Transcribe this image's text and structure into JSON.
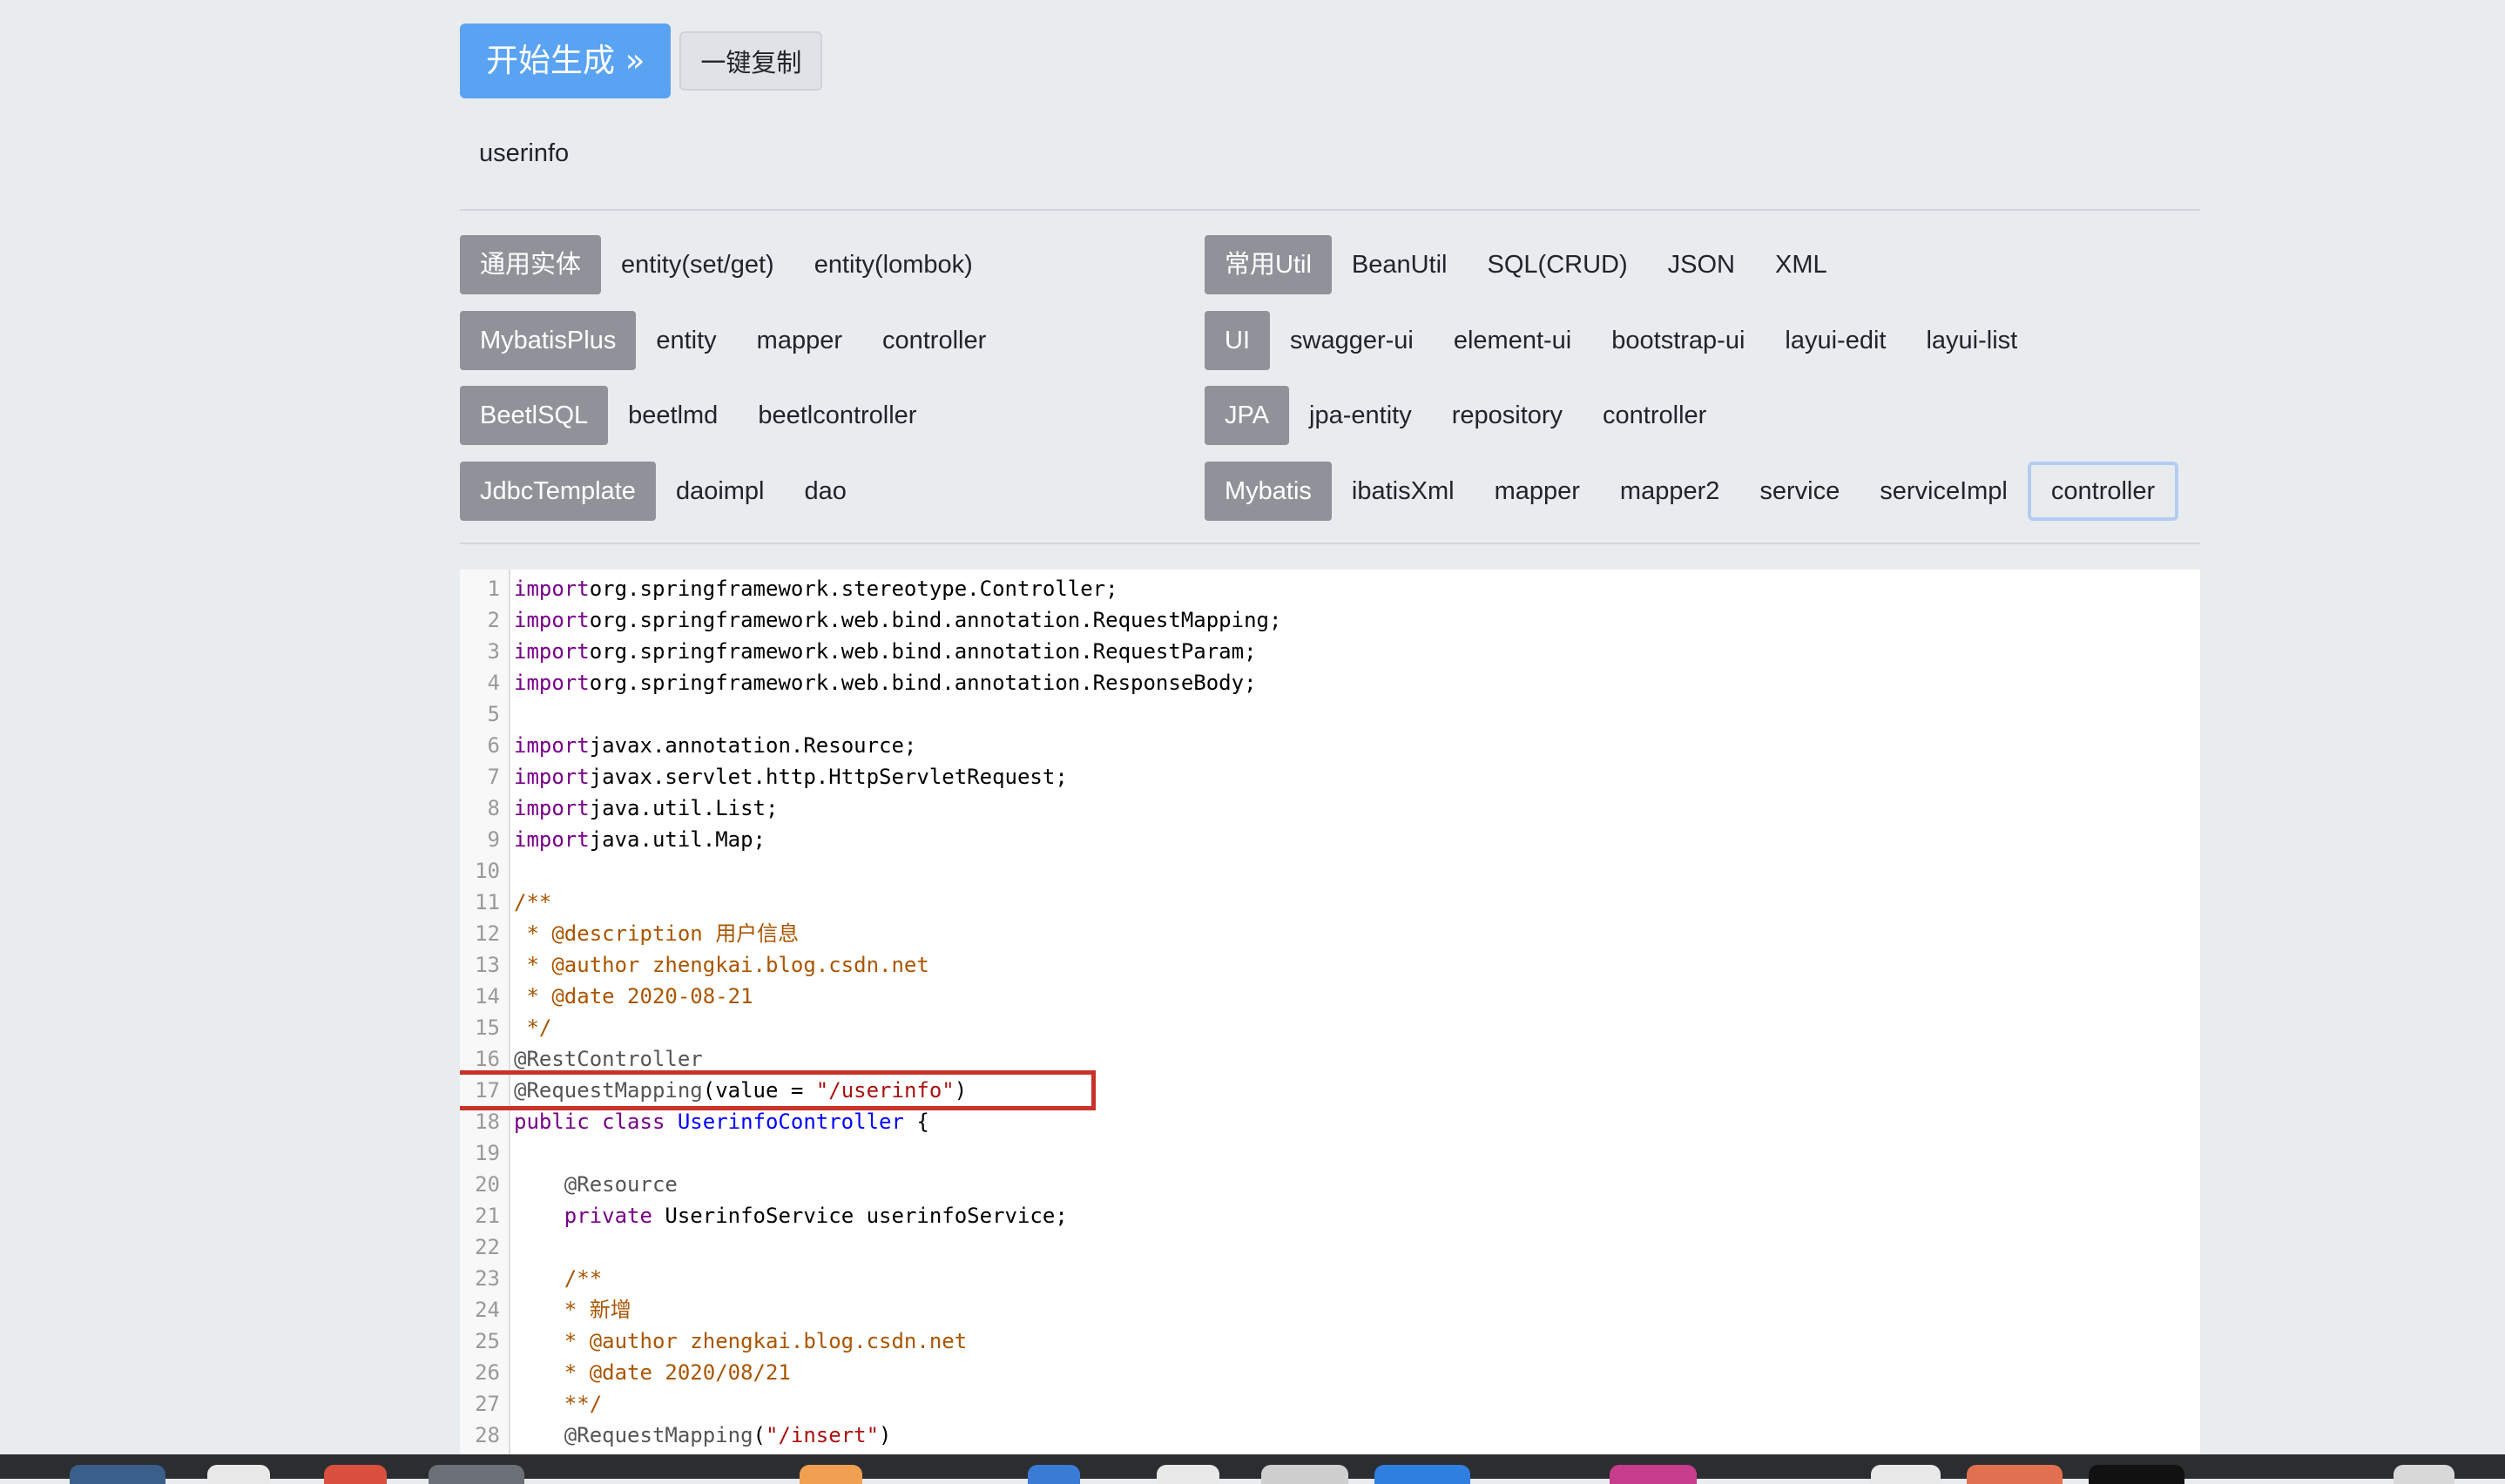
{
  "toolbar": {
    "generate_label": "开始生成 »",
    "copy_label": "一键复制"
  },
  "table_name": "userinfo",
  "templates": {
    "left": [
      {
        "group": "通用实体",
        "items": [
          "entity(set/get)",
          "entity(lombok)"
        ]
      },
      {
        "group": "MybatisPlus",
        "items": [
          "entity",
          "mapper",
          "controller"
        ]
      },
      {
        "group": "BeetlSQL",
        "items": [
          "beetlmd",
          "beetlcontroller"
        ]
      },
      {
        "group": "JdbcTemplate",
        "items": [
          "daoimpl",
          "dao"
        ]
      }
    ],
    "right": [
      {
        "group": "常用Util",
        "items": [
          "BeanUtil",
          "SQL(CRUD)",
          "JSON",
          "XML"
        ]
      },
      {
        "group": "UI",
        "items": [
          "swagger-ui",
          "element-ui",
          "bootstrap-ui",
          "layui-edit",
          "layui-list"
        ]
      },
      {
        "group": "JPA",
        "items": [
          "jpa-entity",
          "repository",
          "controller"
        ]
      },
      {
        "group": "Mybatis",
        "items": [
          "ibatisXml",
          "mapper",
          "mapper2",
          "service",
          "serviceImpl",
          "controller"
        ]
      }
    ],
    "active": "Mybatis/controller"
  },
  "code": {
    "lines": [
      [
        [
          "kw",
          "import"
        ],
        [
          "",
          "org.springframework.stereotype.Controller;"
        ]
      ],
      [
        [
          "kw",
          "import"
        ],
        [
          "",
          "org.springframework.web.bind.annotation.RequestMapping;"
        ]
      ],
      [
        [
          "kw",
          "import"
        ],
        [
          "",
          "org.springframework.web.bind.annotation.RequestParam;"
        ]
      ],
      [
        [
          "kw",
          "import"
        ],
        [
          "",
          "org.springframework.web.bind.annotation.ResponseBody;"
        ]
      ],
      [],
      [
        [
          "kw",
          "import"
        ],
        [
          "",
          "javax.annotation.Resource;"
        ]
      ],
      [
        [
          "kw",
          "import"
        ],
        [
          "",
          "javax.servlet.http.HttpServletRequest;"
        ]
      ],
      [
        [
          "kw",
          "import"
        ],
        [
          "",
          "java.util.List;"
        ]
      ],
      [
        [
          "kw",
          "import"
        ],
        [
          "",
          "java.util.Map;"
        ]
      ],
      [],
      [
        [
          "cmt",
          "/**"
        ]
      ],
      [
        [
          "cmt",
          " * @description 用户信息"
        ]
      ],
      [
        [
          "cmt",
          " * @author zhengkai.blog.csdn.net"
        ]
      ],
      [
        [
          "cmt",
          " * @date 2020-08-21"
        ]
      ],
      [
        [
          "cmt",
          " */"
        ]
      ],
      [
        [
          "meta",
          "@RestController"
        ]
      ],
      [
        [
          "meta",
          "@RequestMapping"
        ],
        [
          "",
          "(value = "
        ],
        [
          "str",
          "\"/userinfo\""
        ],
        [
          "",
          ")"
        ]
      ],
      [
        [
          "kw",
          "public class"
        ],
        [
          "",
          "def:UserinfoController"
        ],
        [
          "",
          " {"
        ]
      ],
      [],
      [
        [
          "meta",
          "    @Resource"
        ]
      ],
      [
        [
          "kw",
          "    private"
        ],
        [
          "",
          " UserinfoService userinfoService;"
        ]
      ],
      [],
      [
        [
          "cmt",
          "    /**"
        ]
      ],
      [
        [
          "cmt",
          "    * 新增"
        ]
      ],
      [
        [
          "cmt",
          "    * @author zhengkai.blog.csdn.net"
        ]
      ],
      [
        [
          "cmt",
          "    * @date 2020/08/21"
        ]
      ],
      [
        [
          "cmt",
          "    **/"
        ]
      ],
      [
        [
          "meta",
          "    @RequestMapping"
        ],
        [
          "",
          "("
        ],
        [
          "str",
          "\"/insert\""
        ],
        [
          "",
          ")"
        ]
      ]
    ],
    "highlighted_line": 17
  },
  "colors": {
    "generate_button": "#5aa3f2",
    "group_label": "#8f9399",
    "highlight_box": "#c8322a",
    "active_border": "#b3cdf2"
  }
}
